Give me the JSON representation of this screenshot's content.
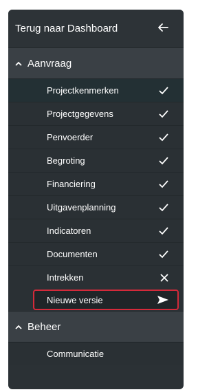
{
  "nav": {
    "back_label": "Terug naar Dashboard",
    "back_icon": "arrow-left-icon"
  },
  "sections": [
    {
      "label": "Aanvraag",
      "items": [
        {
          "label": "Projectkenmerken",
          "status": "check"
        },
        {
          "label": "Projectgegevens",
          "status": "check"
        },
        {
          "label": "Penvoerder",
          "status": "check"
        },
        {
          "label": "Begroting",
          "status": "check"
        },
        {
          "label": "Financiering",
          "status": "check"
        },
        {
          "label": "Uitgavenplanning",
          "status": "check"
        },
        {
          "label": "Indicatoren",
          "status": "check"
        },
        {
          "label": "Documenten",
          "status": "check"
        },
        {
          "label": "Intrekken",
          "status": "cross"
        },
        {
          "label": "Nieuwe versie",
          "status": "send",
          "highlight": true
        }
      ]
    },
    {
      "label": "Beheer",
      "items": [
        {
          "label": "Communicatie"
        }
      ]
    }
  ],
  "colors": {
    "sidebar_bg": "#2b3135",
    "highlight_border": "#d42a3a"
  }
}
